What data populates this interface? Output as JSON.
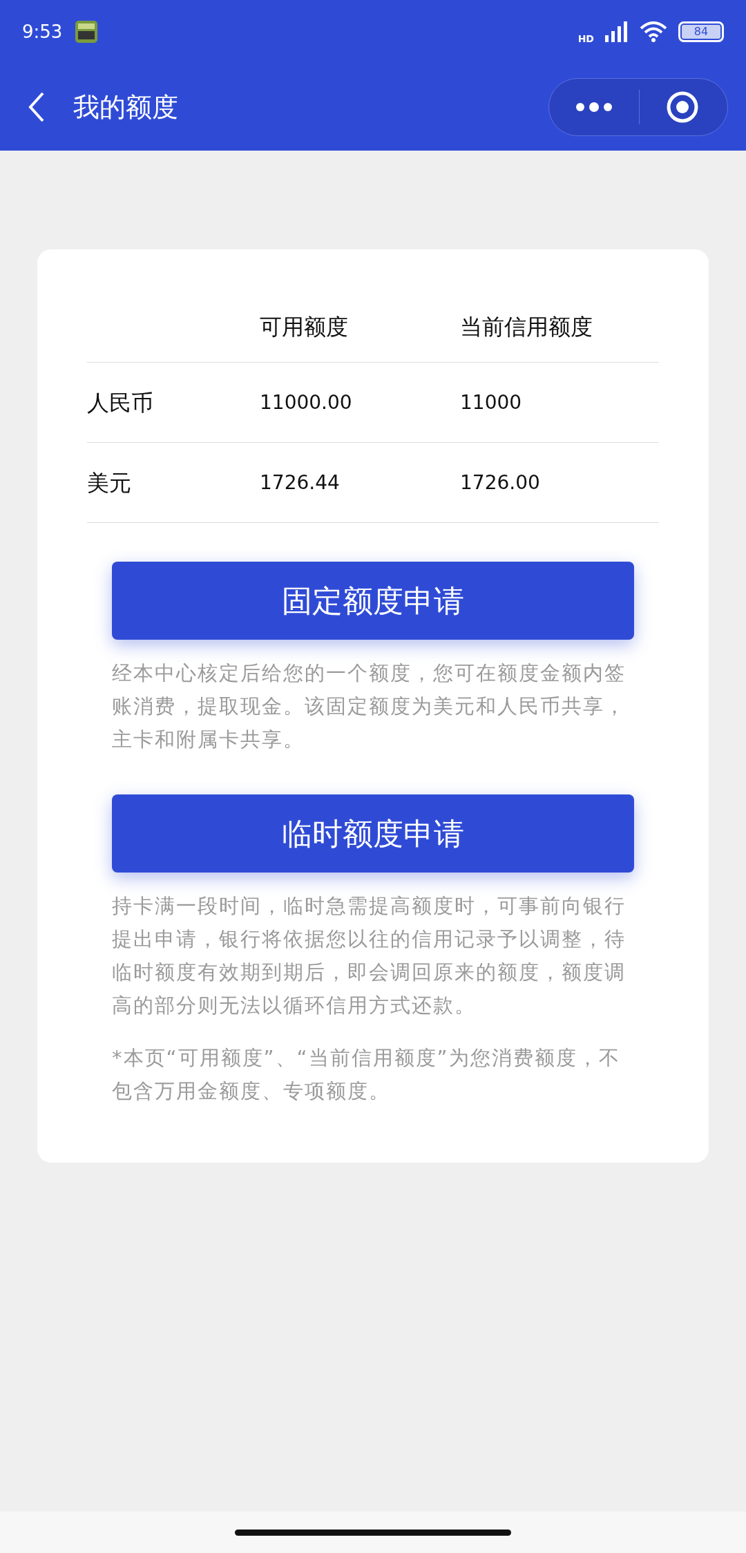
{
  "status_bar": {
    "time": "9:53",
    "battery": "84",
    "network": "HD"
  },
  "nav": {
    "title": "我的额度"
  },
  "table": {
    "columns": [
      "可用额度",
      "当前信用额度"
    ],
    "rows": [
      {
        "currency": "人民币",
        "available": "11000.00",
        "current": "11000"
      },
      {
        "currency": "美元",
        "available": "1726.44",
        "current": "1726.00"
      }
    ]
  },
  "sections": [
    {
      "button": "固定额度申请",
      "description": "经本中心核定后给您的一个额度，您可在额度金额内签账消费，提取现金。该固定额度为美元和人民币共享，主卡和附属卡共享。"
    },
    {
      "button": "临时额度申请",
      "description": "持卡满一段时间，临时急需提高额度时，可事前向银行提出申请，银行将依据您以往的信用记录予以调整，待临时额度有效期到期后，即会调回原来的额度，额度调高的部分则无法以循环信用方式还款。"
    }
  ],
  "note": "*本页“可用额度”、“当前信用额度”为您消费额度，不包含万用金额度、专项额度。"
}
